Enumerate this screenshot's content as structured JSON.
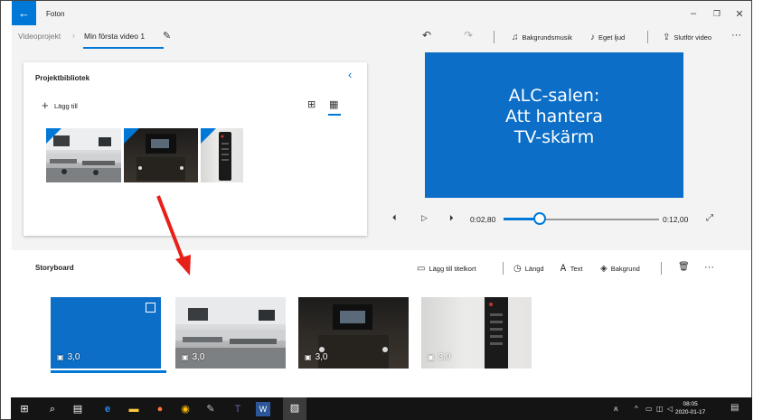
{
  "app": {
    "title": "Foton",
    "back_icon": "arrow-left-icon",
    "window_controls": [
      "minimize-icon",
      "restore-icon",
      "close-icon"
    ]
  },
  "breadcrumb": {
    "parent": "Videoprojekt",
    "current": "Min första video 1",
    "edit_icon": "pencil-icon"
  },
  "toolbar": {
    "undo_icon": "undo-icon",
    "redo_icon": "redo-icon",
    "background_music": "Bakgrundsmusik",
    "custom_audio": "Eget ljud",
    "finish_video": "Slutför video",
    "more_icon": "more-icon"
  },
  "library": {
    "title": "Projektbibliotek",
    "add_label": "Lägg till",
    "thumbnails": [
      {
        "name": "classroom-photo",
        "type": "room"
      },
      {
        "name": "tv-screen-photo",
        "type": "dark"
      },
      {
        "name": "remote-photo",
        "type": "remote"
      }
    ]
  },
  "preview": {
    "lines": [
      "ALC-salen:",
      "Att hantera",
      "TV-skärm"
    ],
    "current_time": "0:02,80",
    "total_time": "0:12,00",
    "progress": 0.2333
  },
  "storyboard": {
    "title": "Storyboard",
    "add_title_card": "Lägg till titelkort",
    "duration": "Längd",
    "text": "Text",
    "background": "Bakgrund",
    "cards": [
      {
        "label": "3,0",
        "type": "title",
        "selected": true
      },
      {
        "label": "3,0",
        "type": "room"
      },
      {
        "label": "3,0",
        "type": "dark"
      },
      {
        "label": "3,0",
        "type": "remote"
      }
    ]
  },
  "taskbar": {
    "time": "08:05",
    "date": "2020-01-17"
  },
  "colors": {
    "accent": "#0078d7",
    "preview_bg": "#0c6ec7",
    "arrow": "#e8201a"
  }
}
